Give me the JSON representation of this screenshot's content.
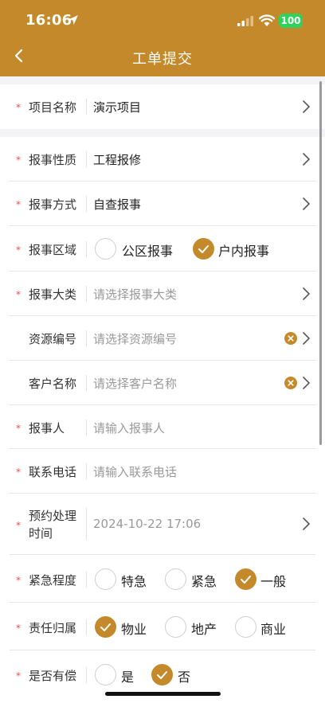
{
  "status_bar": {
    "time": "16:06",
    "battery": "100"
  },
  "header": {
    "title": "工单提交"
  },
  "form": {
    "project": {
      "label": "项目名称",
      "value": "演示项目"
    },
    "nature": {
      "label": "报事性质",
      "value": "工程报修"
    },
    "method": {
      "label": "报事方式",
      "value": "自查报事"
    },
    "area": {
      "label": "报事区域",
      "options": [
        "公区报事",
        "户内报事"
      ],
      "selected": "户内报事"
    },
    "category": {
      "label": "报事大类",
      "placeholder": "请选择报事大类"
    },
    "resource": {
      "label": "资源编号",
      "placeholder": "请选择资源编号"
    },
    "customer": {
      "label": "客户名称",
      "placeholder": "请选择客户名称"
    },
    "reporter": {
      "label": "报事人",
      "placeholder": "请输入报事人"
    },
    "phone": {
      "label": "联系电话",
      "placeholder": "请输入联系电话"
    },
    "appointment": {
      "label_line1": "预约处理",
      "label_line2": "时间",
      "value": "2024-10-22 17:06"
    },
    "urgency": {
      "label": "紧急程度",
      "options": [
        "特急",
        "紧急",
        "一般"
      ],
      "selected": "一般"
    },
    "responsibility": {
      "label": "责任归属",
      "options": [
        "物业",
        "地产",
        "商业"
      ],
      "selected": "物业"
    },
    "compensation": {
      "label": "是否有偿",
      "options": [
        "是",
        "否"
      ],
      "selected": "否"
    }
  },
  "colors": {
    "brand": "#c4892a",
    "required": "#e8504a",
    "battery": "#2fd35c"
  },
  "required_mark": "*"
}
